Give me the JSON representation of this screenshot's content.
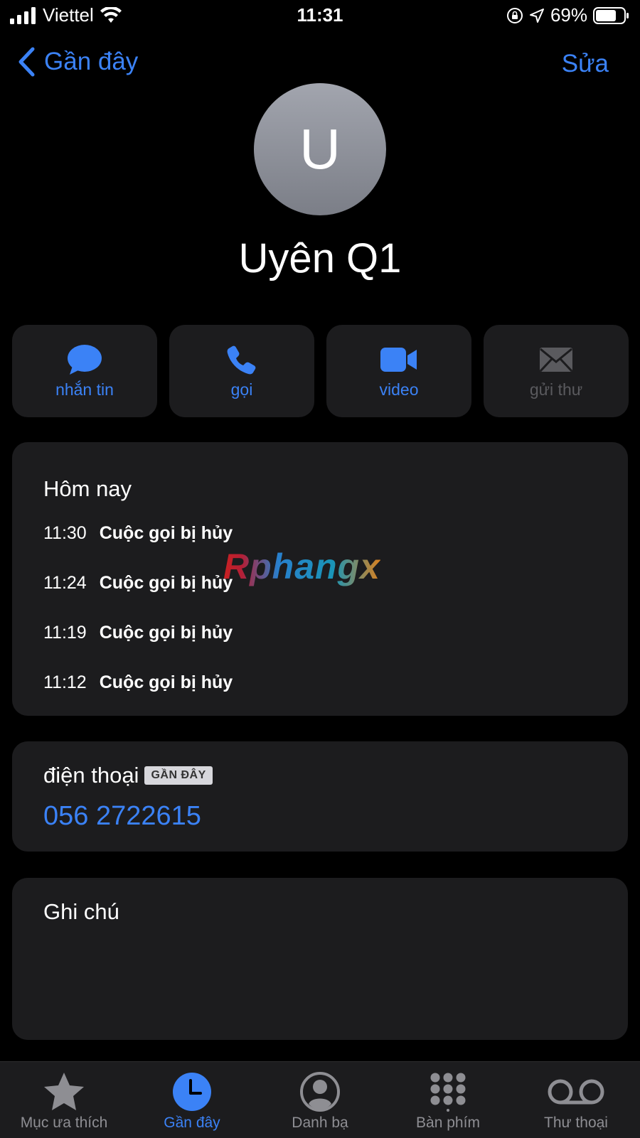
{
  "status_bar": {
    "carrier": "Viettel",
    "time": "11:31",
    "battery_percent": "69%"
  },
  "nav": {
    "back_label": "Gần đây",
    "edit_label": "Sửa"
  },
  "contact": {
    "initial": "U",
    "name": "Uyên Q1"
  },
  "actions": [
    {
      "label": "nhắn tin",
      "icon": "message-icon",
      "enabled": true
    },
    {
      "label": "gọi",
      "icon": "phone-icon",
      "enabled": true
    },
    {
      "label": "video",
      "icon": "video-icon",
      "enabled": true
    },
    {
      "label": "gửi thư",
      "icon": "mail-icon",
      "enabled": false
    }
  ],
  "recents": {
    "header": "Hôm nay",
    "calls": [
      {
        "time": "11:30",
        "status": "Cuộc gọi bị hủy"
      },
      {
        "time": "11:24",
        "status": "Cuộc gọi bị hủy"
      },
      {
        "time": "11:19",
        "status": "Cuộc gọi bị hủy"
      },
      {
        "time": "11:12",
        "status": "Cuộc gọi bị hủy"
      }
    ]
  },
  "phone": {
    "label": "điện thoại",
    "badge": "GẦN ĐÂY",
    "number": "056 2722615"
  },
  "notes": {
    "label": "Ghi chú"
  },
  "watermark": "Rphangx",
  "tab_bar": {
    "items": [
      {
        "label": "Mục ưa thích",
        "icon": "star-icon",
        "active": false
      },
      {
        "label": "Gần đây",
        "icon": "clock-icon",
        "active": true
      },
      {
        "label": "Danh bạ",
        "icon": "person-icon",
        "active": false
      },
      {
        "label": "Bàn phím",
        "icon": "keypad-icon",
        "active": false
      },
      {
        "label": "Thư thoại",
        "icon": "voicemail-icon",
        "active": false
      }
    ]
  },
  "colors": {
    "accent": "#3b82f6",
    "card_bg": "#1c1c1e",
    "background": "#000000"
  }
}
